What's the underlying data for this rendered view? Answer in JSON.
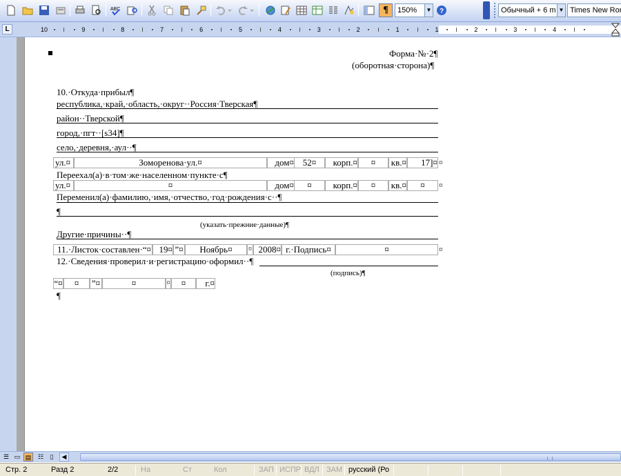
{
  "toolbar": {
    "zoom": "150%",
    "style": "Обычный + 6 m",
    "font": "Times New Rom",
    "icons": [
      "new-icon",
      "open-icon",
      "save-icon",
      "permissions-icon",
      "print-icon",
      "print-preview-icon",
      "spelling-icon",
      "research-icon",
      "cut-icon",
      "copy-icon",
      "paste-icon",
      "format-painter-icon",
      "undo-icon",
      "redo-icon",
      "hyperlink-icon",
      "drawing-icon",
      "table-icon",
      "insert-excel-icon",
      "columns-icon",
      "drawing-toolbar-icon",
      "document-map-icon",
      "show-formatting-icon",
      "help-icon"
    ]
  },
  "ruler": {
    "numbers": [
      "10",
      "9",
      "8",
      "7",
      "6",
      "5",
      "4",
      "3",
      "2",
      "1",
      "1",
      "2",
      "3",
      "4"
    ]
  },
  "document": {
    "form_number": "Форма·№·2¶",
    "back_side": "(оборотная·сторона)¶",
    "l10": "10.·Откуда·прибыл¶",
    "republic": "республика,·край,·область,·округ··Россия·Тверская¶",
    "district": "район··Тверской¶",
    "city": "город,·пгт··[s34]¶",
    "village": "село,·деревня,·аул··¶",
    "street_label": "ул.¤",
    "street_value": "Зоморенова·ул.¤",
    "house_label": "дом¤",
    "house_value": "52¤",
    "block_label": "корп.¤",
    "block_value": "¤",
    "apt_label": "кв.¤",
    "apt_value": "17]¤",
    "end_cell": "¤",
    "moved": "Переехал(а)·в·том·же·населенном·пункте·с¶",
    "street2_label": "ул.¤",
    "street2_value": "¤",
    "house2_label": "дом¤",
    "house2_value": "¤",
    "block2_label": "корп.¤",
    "block2_value": "¤",
    "apt2_label": "кв.¤",
    "apt2_value": "¤",
    "changed": "Переменил(а)·фамилию,·имя,·отчество,·год·рождения·с··¶",
    "empty_para": "¶",
    "note_prev": "(указать·прежние·данные)¶",
    "other": "Другие·причины··¶",
    "l11_label": "11.·Листок·составлен·“¤",
    "l11_day": "19¤",
    "l11_quote": "”¤",
    "l11_month": "Ноябрь¤",
    "l11_spacer": "¤",
    "l11_year": "2008¤",
    "l11_sign": "г.·Подпись¤",
    "l11_sign_value": "¤",
    "l11_end": "¤",
    "l12": "12.·Сведения·проверил·и·регистрацию·оформил··¶",
    "sign_note": "(подпись)¶",
    "date_open": "“¤",
    "date_day": "¤",
    "date_close": "”¤",
    "date_month": "¤",
    "date_sep": "¤",
    "date_year": "¤",
    "date_g": "г.¤",
    "last_para": "¶"
  },
  "status": {
    "page": "Стр. 2",
    "section": "Разд 2",
    "pages": "2/2",
    "at": "На",
    "line": "Ст",
    "col": "Кол",
    "rec": "ЗАП",
    "trk": "ИСПР",
    "ext": "ВДЛ",
    "ovr": "ЗАМ",
    "lang": "русский (Ро"
  },
  "colors": {
    "toolbar_bg": "#c3d3f3",
    "active_button": "#f5b55d",
    "page_bg": "#ffffff",
    "status_bg": "#ece9d8"
  }
}
